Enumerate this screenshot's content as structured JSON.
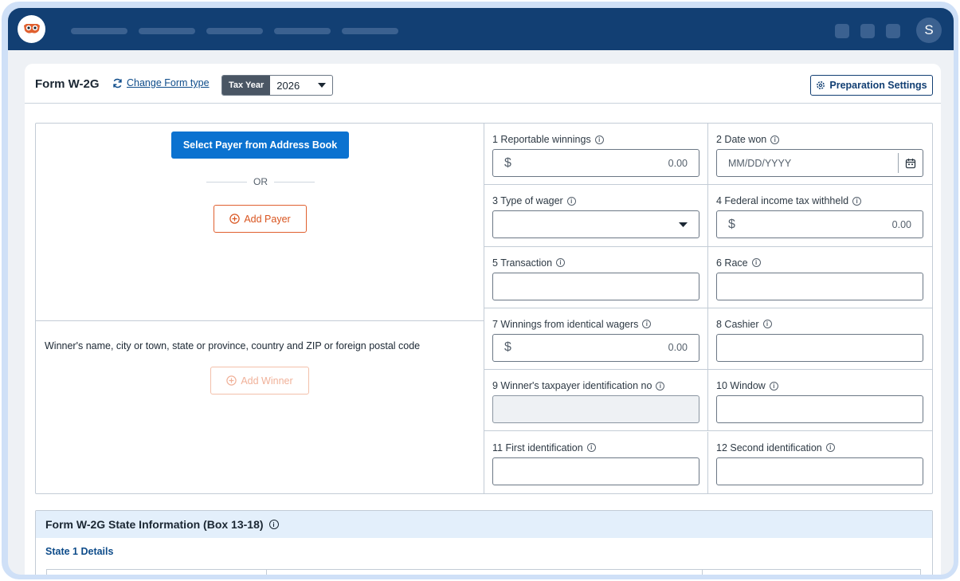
{
  "user": {
    "initial": "S"
  },
  "header": {
    "form_title": "Form W-2G",
    "change_form_link": "Change Form type",
    "tax_year_label": "Tax Year",
    "tax_year_value": "2026",
    "preparation_settings": "Preparation Settings"
  },
  "payer": {
    "select_button": "Select Payer from Address Book",
    "or_text": "OR",
    "add_button": "Add Payer"
  },
  "winner": {
    "label": "Winner's name, city or town, state or province, country and ZIP or foreign postal code",
    "add_button": "Add Winner"
  },
  "boxes": {
    "b1": {
      "label": "1  Reportable winnings",
      "currency": "$",
      "value": "0.00"
    },
    "b2": {
      "label": "2  Date won",
      "placeholder": "MM/DD/YYYY"
    },
    "b3": {
      "label": "3  Type of wager",
      "value": ""
    },
    "b4": {
      "label": "4  Federal income tax withheld",
      "currency": "$",
      "value": "0.00"
    },
    "b5": {
      "label": "5  Transaction",
      "value": ""
    },
    "b6": {
      "label": "6  Race",
      "value": ""
    },
    "b7": {
      "label": "7  Winnings from identical wagers",
      "currency": "$",
      "value": "0.00"
    },
    "b8": {
      "label": "8  Cashier",
      "value": ""
    },
    "b9": {
      "label": "9  Winner's taxpayer identification no",
      "value": ""
    },
    "b10": {
      "label": "10  Window",
      "value": ""
    },
    "b11": {
      "label": "11  First identification",
      "value": ""
    },
    "b12": {
      "label": "12  Second identification",
      "value": ""
    }
  },
  "state": {
    "title": "Form W-2G State Information (Box 13-18)",
    "subtitle": "State 1 Details"
  },
  "colors": {
    "topbar": "#123f73",
    "primary": "#0b72d0",
    "accent_orange": "#e0602f"
  },
  "icons": {
    "logo": "owl-logo-icon",
    "refresh": "refresh-icon",
    "gear": "gear-icon",
    "info": "info-icon",
    "calendar": "calendar-icon",
    "add": "plus-circle-icon",
    "caret": "caret-down-icon"
  }
}
